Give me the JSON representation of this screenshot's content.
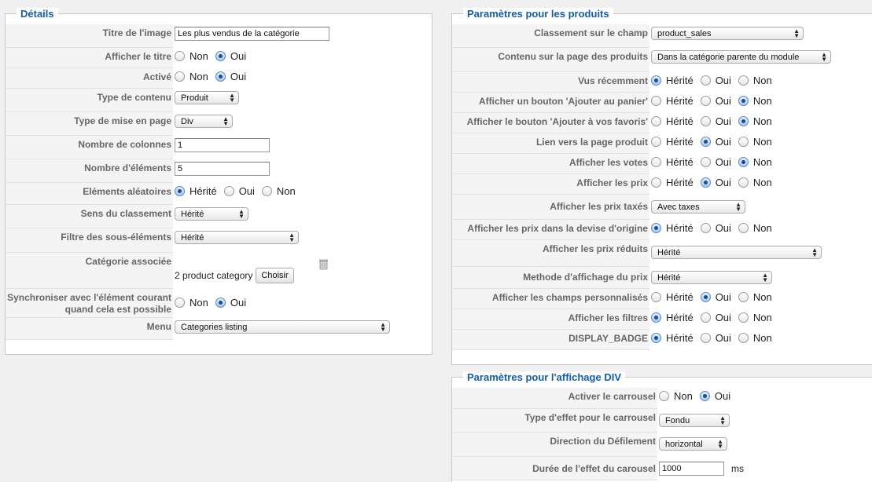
{
  "details": {
    "legend": "Détails",
    "rows": [
      {
        "label": "Titre de l'image",
        "value": "Les plus vendus de la catégorie"
      },
      {
        "label": "Afficher le titre",
        "options": [
          "Non",
          "Oui"
        ],
        "selected": "Oui"
      },
      {
        "label": "Activé",
        "options": [
          "Non",
          "Oui"
        ],
        "selected": "Oui"
      },
      {
        "label": "Type de contenu",
        "value": "Produit"
      },
      {
        "label": "Type de mise en page",
        "value": "Div"
      },
      {
        "label": "Nombre de colonnes",
        "value": "1"
      },
      {
        "label": "Nombre d'éléments",
        "value": "5"
      },
      {
        "label": "Eléments aléatoires",
        "options": [
          "Hérité",
          "Oui",
          "Non"
        ],
        "selected": "Hérité"
      },
      {
        "label": "Sens du classement",
        "value": "Hérité"
      },
      {
        "label": "Filtre des sous-éléments",
        "value": "Hérité"
      },
      {
        "label": "Catégorie associée",
        "value": "2 product category",
        "button": "Choisir"
      },
      {
        "label": "Synchroniser avec l'élément courant quand cela est possible",
        "options": [
          "Non",
          "Oui"
        ],
        "selected": "Oui"
      },
      {
        "label": "Menu",
        "value": "Categories listing"
      }
    ]
  },
  "products": {
    "legend": "Paramètres pour les produits",
    "rows": [
      {
        "label": "Classement sur le champ",
        "value": "product_sales"
      },
      {
        "label": "Contenu sur la page des produits",
        "value": "Dans la catégorie parente du module"
      },
      {
        "label": "Vus récemment",
        "options": [
          "Hérité",
          "Oui",
          "Non"
        ],
        "selected": "Hérité"
      },
      {
        "label": "Afficher un bouton 'Ajouter au panier'",
        "options": [
          "Hérité",
          "Oui",
          "Non"
        ],
        "selected": "Non"
      },
      {
        "label": "Afficher le bouton 'Ajouter à vos favoris'",
        "options": [
          "Hérité",
          "Oui",
          "Non"
        ],
        "selected": "Non"
      },
      {
        "label": "Lien vers la page produit",
        "options": [
          "Hérité",
          "Oui",
          "Non"
        ],
        "selected": "Oui"
      },
      {
        "label": "Afficher les votes",
        "options": [
          "Hérité",
          "Oui",
          "Non"
        ],
        "selected": "Non"
      },
      {
        "label": "Afficher les prix",
        "options": [
          "Hérité",
          "Oui",
          "Non"
        ],
        "selected": "Oui"
      },
      {
        "label": "Afficher les prix taxés",
        "value": "Avec taxes"
      },
      {
        "label": "Afficher les prix dans la devise d'origine",
        "options": [
          "Hérité",
          "Oui",
          "Non"
        ],
        "selected": "Hérité"
      },
      {
        "label": "Afficher les prix réduits",
        "value": "Hérité"
      },
      {
        "label": "Methode d'affichage du prix",
        "value": "Hérité"
      },
      {
        "label": "Afficher les champs personnalisés",
        "options": [
          "Hérité",
          "Oui",
          "Non"
        ],
        "selected": "Oui"
      },
      {
        "label": "Afficher les filtres",
        "options": [
          "Hérité",
          "Oui",
          "Non"
        ],
        "selected": "Hérité"
      },
      {
        "label": "DISPLAY_BADGE",
        "options": [
          "Hérité",
          "Oui",
          "Non"
        ],
        "selected": "Hérité"
      }
    ]
  },
  "div_display": {
    "legend": "Paramètres pour l'affichage DIV",
    "rows": [
      {
        "label": "Activer le carrousel",
        "options": [
          "Non",
          "Oui"
        ],
        "selected": "Oui"
      },
      {
        "label": "Type d'effet pour le carrousel",
        "value": "Fondu"
      },
      {
        "label": "Direction du Défilement",
        "value": "horizontal"
      },
      {
        "label": "Durée de l'effet du carousel",
        "value": "1000",
        "unit": "ms"
      }
    ]
  },
  "icons": {
    "delete_category": "trash-icon"
  },
  "colors": {
    "legend": "#135cae",
    "label": "#666666",
    "row_bg": "#f4f4f4",
    "radio_selected": "#1a4d8f"
  }
}
